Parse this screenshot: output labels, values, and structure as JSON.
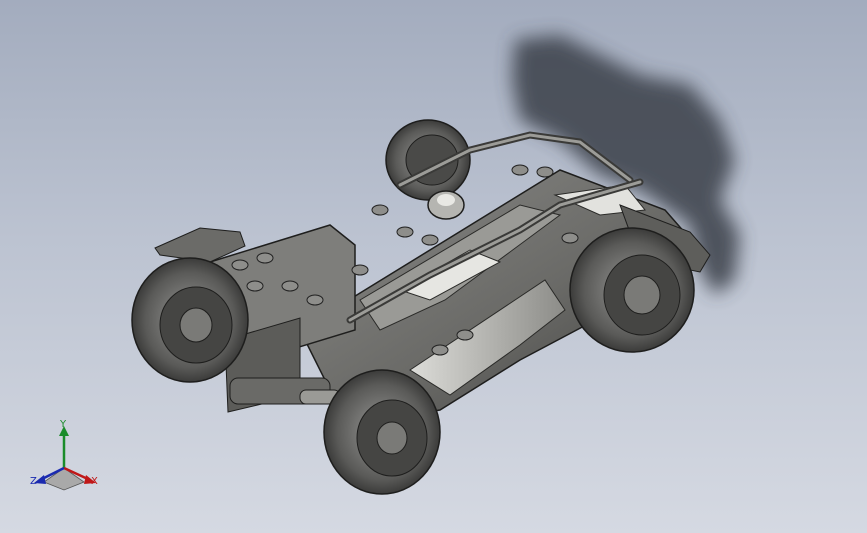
{
  "viewport": {
    "background_top": "#a3acbe",
    "background_bottom": "#d5d9e2",
    "model_color": "#6e6e6e",
    "shadow_color": "#3b3f4a"
  },
  "triad": {
    "y_label": "Y",
    "x_label": "X",
    "z_label": "Z",
    "y_color": "#1a8c2a",
    "x_color": "#c01818",
    "z_color": "#1a2ab0"
  }
}
